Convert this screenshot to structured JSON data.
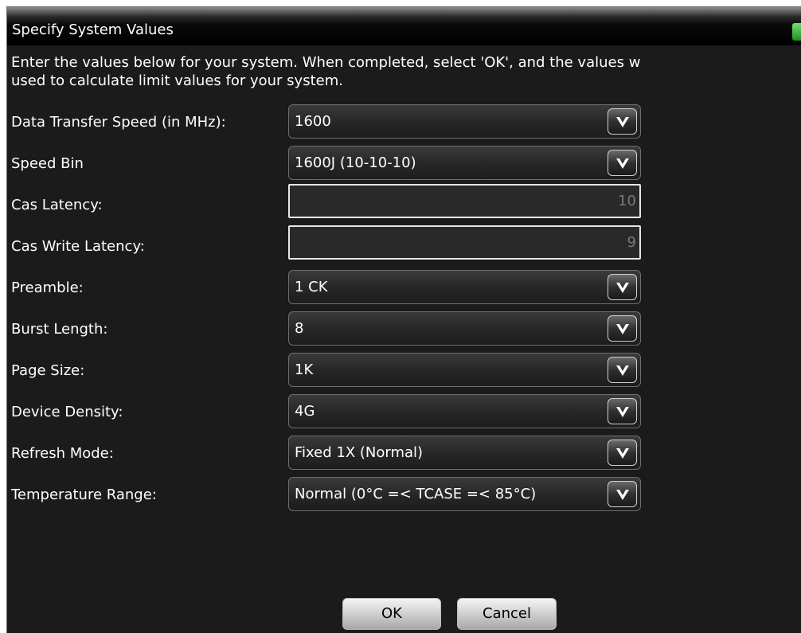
{
  "dialog": {
    "title": "Specify System Values",
    "instructions": "Enter the values below for your system. When completed, select 'OK', and the values w\nused to calculate limit values for your system."
  },
  "fields": {
    "data_transfer_speed": {
      "label": "Data Transfer Speed (in MHz):",
      "value": "1600"
    },
    "speed_bin": {
      "label": "Speed Bin",
      "value": "1600J (10-10-10)"
    },
    "cas_latency": {
      "label": "Cas Latency:",
      "value": "10"
    },
    "cas_write_latency": {
      "label": "Cas Write Latency:",
      "value": "9"
    },
    "preamble": {
      "label": "Preamble:",
      "value": "1 CK"
    },
    "burst_length": {
      "label": "Burst Length:",
      "value": "8"
    },
    "page_size": {
      "label": "Page Size:",
      "value": "1K"
    },
    "device_density": {
      "label": "Device Density:",
      "value": "4G"
    },
    "refresh_mode": {
      "label": "Refresh Mode:",
      "value": "Fixed 1X (Normal)"
    },
    "temperature_range": {
      "label": "Temperature Range:",
      "value": "Normal (0°C =< TCASE =< 85°C)"
    }
  },
  "buttons": {
    "ok": "OK",
    "cancel": "Cancel"
  },
  "icons": {
    "dropdown": "chevron-down-icon",
    "status": "status-led-icon"
  },
  "colors": {
    "background": "#1b1b1b",
    "text": "#ffffff",
    "readonly_text": "#7a7a7a",
    "led": "#3cb43c"
  }
}
